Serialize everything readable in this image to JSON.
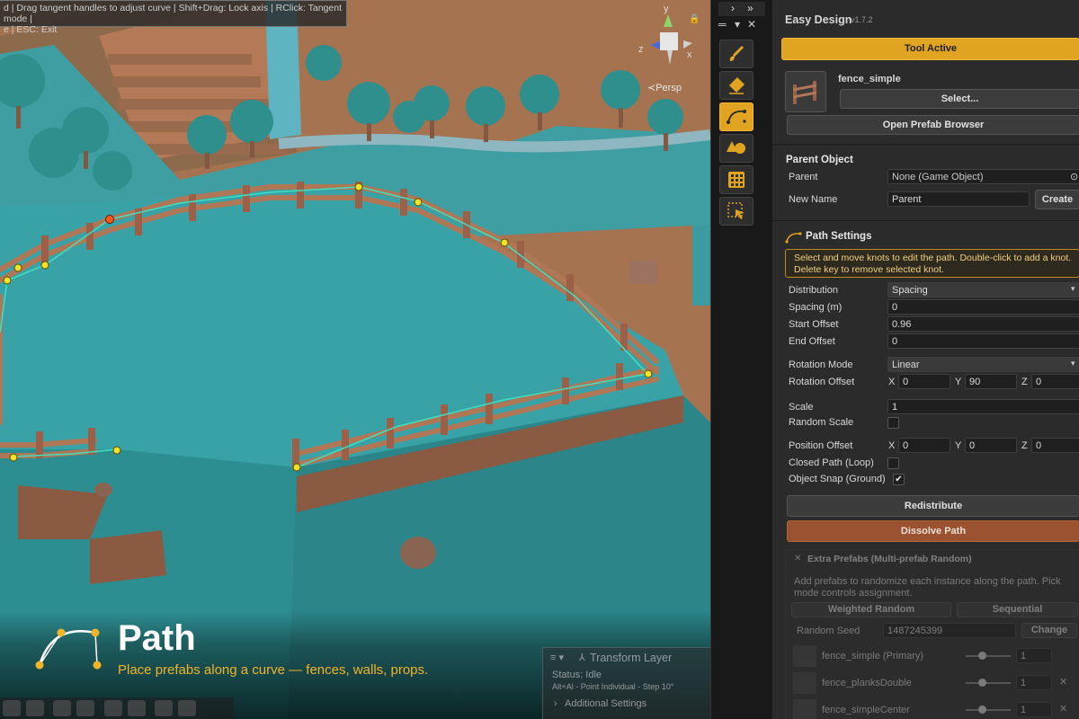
{
  "scene": {
    "hint_lines": [
      "d | Drag tangent handles to adjust curve | Shift+Drag: Lock axis | RClick: Tangent mode |",
      "e | ESC: Exit"
    ],
    "gizmo_axis_y": "y",
    "gizmo_axis_z": "z",
    "gizmo_axis_x": "x",
    "persp_label": "≺Persp",
    "caption_title": "Path",
    "caption_subtitle": "Place prefabs along a curve — fences, walls, props.",
    "transform_layer": {
      "title": "Transform Layer",
      "status": "Status: Idle",
      "info": "Alt+Al - Point Individual - Step 10°",
      "additional": "Additional Settings"
    },
    "colors": {
      "ground": "#3aa2a6",
      "dirt": "#a5734f",
      "fence": "#b07757",
      "accent": "#f0b429"
    }
  },
  "toolstrip": {
    "nav": [
      "›",
      "»"
    ],
    "tools": [
      {
        "icon": "brush-icon",
        "active": false
      },
      {
        "icon": "eraser-icon",
        "active": false
      },
      {
        "icon": "path-curve-icon",
        "active": true
      },
      {
        "icon": "shapes-icon",
        "active": false
      },
      {
        "icon": "grid-icon",
        "active": false
      },
      {
        "icon": "selection-icon",
        "active": false
      }
    ]
  },
  "inspector": {
    "title": "Easy Design",
    "version": "v1.7.2",
    "tool_active": "Tool Active",
    "prefab_name": "fence_simple",
    "select_button": "Select...",
    "open_browser": "Open Prefab Browser",
    "parent_object": {
      "header": "Parent Object",
      "parent_label": "Parent",
      "parent_value": "None (Game Object)",
      "new_name_label": "New Name",
      "new_name_value": "Parent",
      "create": "Create"
    },
    "path_settings": {
      "header": "Path Settings",
      "help_line1": "Select and move knots to edit the path. Double-click to add a knot.",
      "help_line2": "Delete key to remove selected knot.",
      "distribution_label": "Distribution",
      "distribution_value": "Spacing",
      "spacing_label": "Spacing (m)",
      "spacing_value": "0",
      "start_offset_label": "Start Offset",
      "start_offset_value": "0.96",
      "end_offset_label": "End Offset",
      "end_offset_value": "0",
      "rotation_mode_label": "Rotation Mode",
      "rotation_mode_value": "Linear",
      "rotation_offset_label": "Rotation Offset",
      "rotation_offset": {
        "x": "0",
        "y": "90",
        "z": "0"
      },
      "scale_label": "Scale",
      "scale_value": "1",
      "random_scale_label": "Random Scale",
      "position_offset_label": "Position Offset",
      "position_offset": {
        "x": "0",
        "y": "0",
        "z": "0"
      },
      "closed_path_label": "Closed Path (Loop)",
      "object_snap_label": "Object Snap (Ground)",
      "object_snap_check": "✔",
      "axis_x": "X",
      "axis_y": "Y",
      "axis_z": "Z",
      "redistribute": "Redistribute",
      "dissolve": "Dissolve Path"
    },
    "extra_prefabs": {
      "header": "Extra Prefabs (Multi-prefab Random)",
      "desc_line1": "Add prefabs to randomize each instance along the path. Pick",
      "desc_line2": "mode controls assignment.",
      "weighted": "Weighted Random",
      "sequential": "Sequential",
      "seed_label": "Random Seed",
      "seed_value": "1487245399",
      "change": "Change",
      "items": [
        {
          "name": "fence_simple (Primary)",
          "weight": "1"
        },
        {
          "name": "fence_planksDouble",
          "weight": "1"
        },
        {
          "name": "fence_simpleCenter",
          "weight": "1"
        }
      ]
    }
  }
}
